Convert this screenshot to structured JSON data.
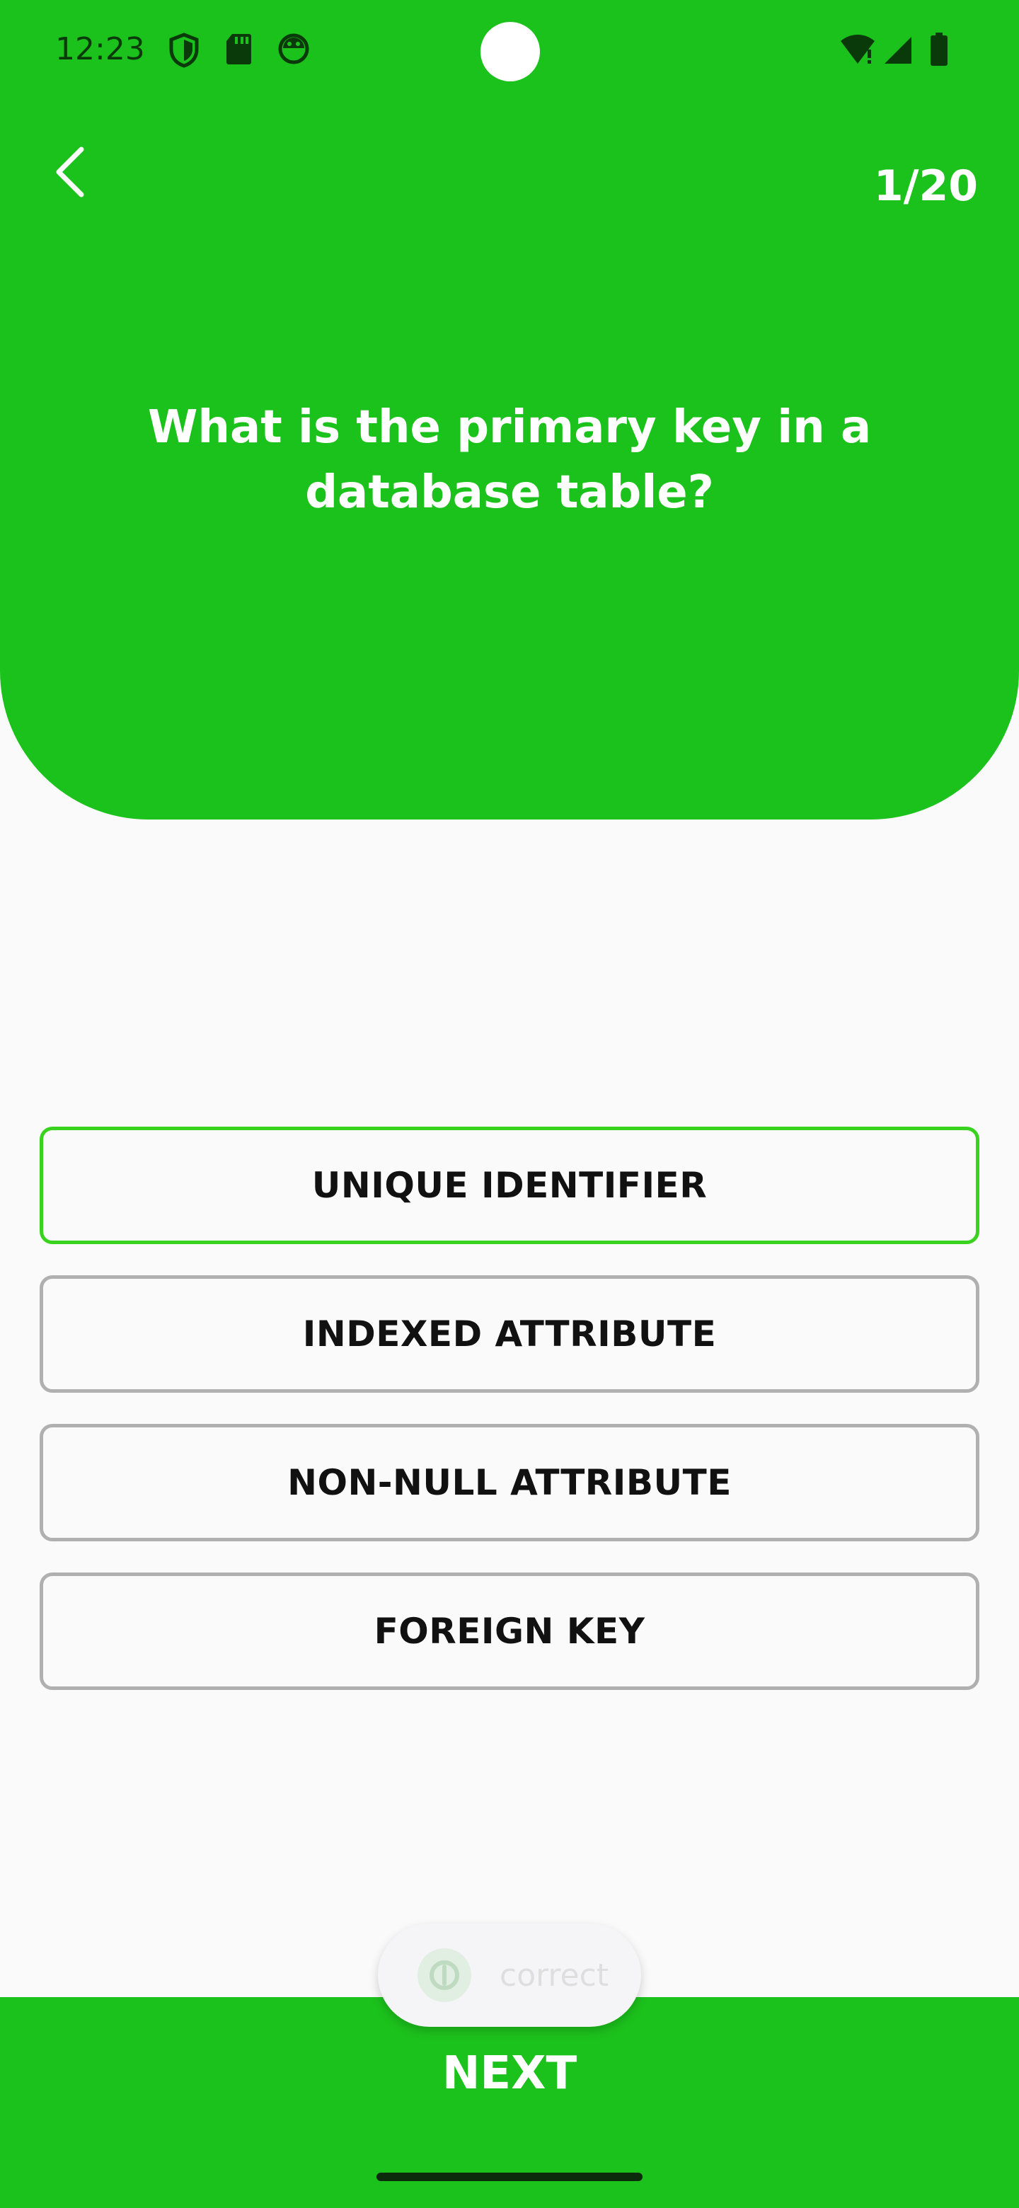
{
  "status_bar": {
    "time": "12:23",
    "left_icons": [
      "shield-icon",
      "sd-card-icon",
      "android-icon"
    ],
    "right_icons": [
      "wifi-icon",
      "signal-icon",
      "battery-icon"
    ]
  },
  "header": {
    "back_icon": "chevron-left-icon",
    "counter": "1/20",
    "question": "What is the primary key in a database table?",
    "color": "#1cc21c"
  },
  "answers": [
    {
      "label": "UNIQUE IDENTIFIER",
      "selected": true
    },
    {
      "label": "INDEXED ATTRIBUTE",
      "selected": false
    },
    {
      "label": "NON-NULL ATTRIBUTE",
      "selected": false
    },
    {
      "label": "FOREIGN KEY",
      "selected": false
    }
  ],
  "toast": {
    "text": "correct",
    "icon": "app-logo-icon"
  },
  "footer": {
    "next_label": "NEXT",
    "color": "#1cc21c"
  },
  "colors": {
    "selected_border": "#39d31f",
    "default_border": "#b0b0b0"
  }
}
